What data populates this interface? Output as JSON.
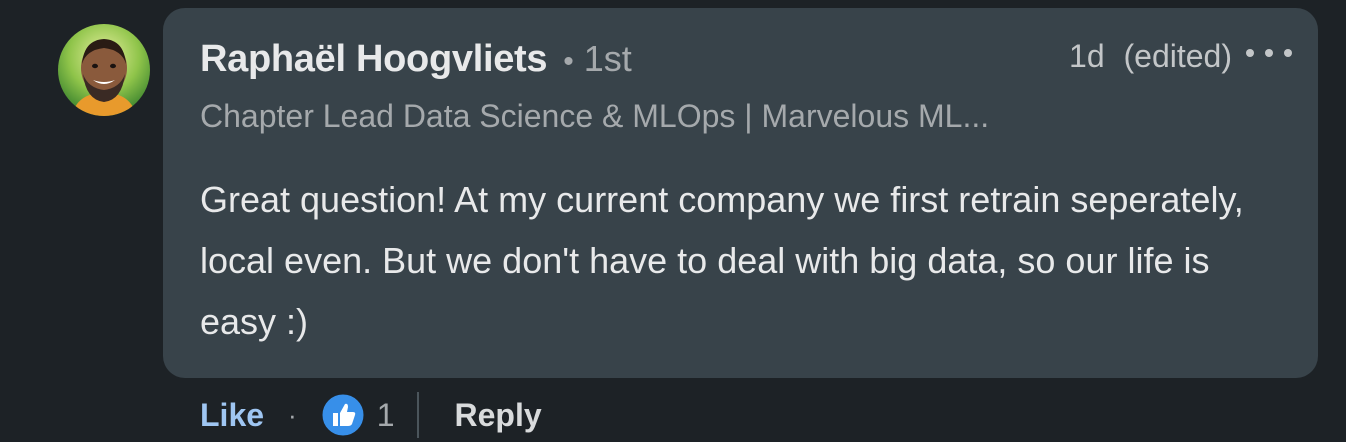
{
  "comment": {
    "author": {
      "name": "Raphaël Hoogvliets",
      "separator": "•",
      "connection_degree": "1st",
      "headline": "Chapter Lead Data Science & MLOps | Marvelous ML..."
    },
    "timestamp": "1d",
    "edited_label": "(edited)",
    "body": "Great question! At my current company we first retrain seperately, local even. But we don't have to deal with big data, so our life is easy :)"
  },
  "actions": {
    "like_label": "Like",
    "separator": "·",
    "reaction_icon": "thumbs-up-icon",
    "reaction_count": "1",
    "reply_label": "Reply"
  },
  "colors": {
    "page_background": "#1d2226",
    "bubble_background": "#38434a",
    "like_link": "#9fc6f2",
    "reaction_blue": "#378fe9"
  }
}
